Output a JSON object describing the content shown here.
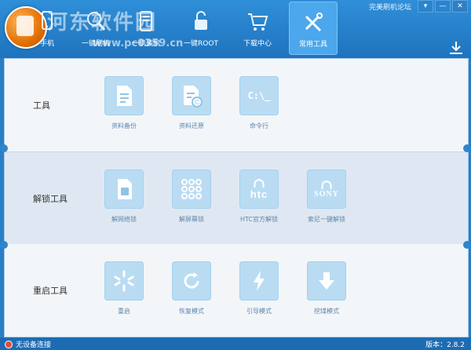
{
  "window": {
    "forum_link": "完美刷机论坛",
    "min_glyph": "—",
    "close_glyph": "✕",
    "dropdown_glyph": "▾"
  },
  "watermark": {
    "text": "河东软件园",
    "url": "www.pc0359.cn"
  },
  "nav": {
    "tabs": [
      {
        "label": "手机",
        "icon": "phone-icon"
      },
      {
        "label": "一键刷机",
        "icon": "brush-icon"
      },
      {
        "label": "一机装机",
        "icon": "install-icon"
      },
      {
        "label": "一键ROOT",
        "icon": "unlock-icon"
      },
      {
        "label": "下载中心",
        "icon": "cart-icon"
      },
      {
        "label": "常用工具",
        "icon": "tools-icon"
      }
    ],
    "active": "常用工具"
  },
  "sections": [
    {
      "label": "工具",
      "tools": [
        {
          "label": "资料备份",
          "icon": "document-icon"
        },
        {
          "label": "资料还原",
          "icon": "restore-document-icon"
        },
        {
          "label": "命令行",
          "icon": "terminal-icon"
        }
      ]
    },
    {
      "label": "解锁工具",
      "tools": [
        {
          "label": "解网络锁",
          "icon": "sim-card-icon"
        },
        {
          "label": "解屏幕锁",
          "icon": "pattern-lock-icon"
        },
        {
          "label": "HTC官方解锁",
          "icon": "htc-lock-icon"
        },
        {
          "label": "索尼一键解锁",
          "icon": "sony-lock-icon"
        }
      ]
    },
    {
      "label": "重启工具",
      "tools": [
        {
          "label": "重启",
          "icon": "restart-icon"
        },
        {
          "label": "恢复模式",
          "icon": "recovery-icon"
        },
        {
          "label": "引导模式",
          "icon": "bolt-icon"
        },
        {
          "label": "挖煤模式",
          "icon": "download-arrow-icon"
        }
      ]
    }
  ],
  "tile_text": {
    "terminal": "C:\\_",
    "htc": "htc",
    "sony": "SONY"
  },
  "status": {
    "left": "无设备连接",
    "right": "版本：2.8.2"
  },
  "colors": {
    "primary": "#2a7ec6",
    "tile": "#b9dcf3",
    "active_tab": "#4ca7ec"
  }
}
